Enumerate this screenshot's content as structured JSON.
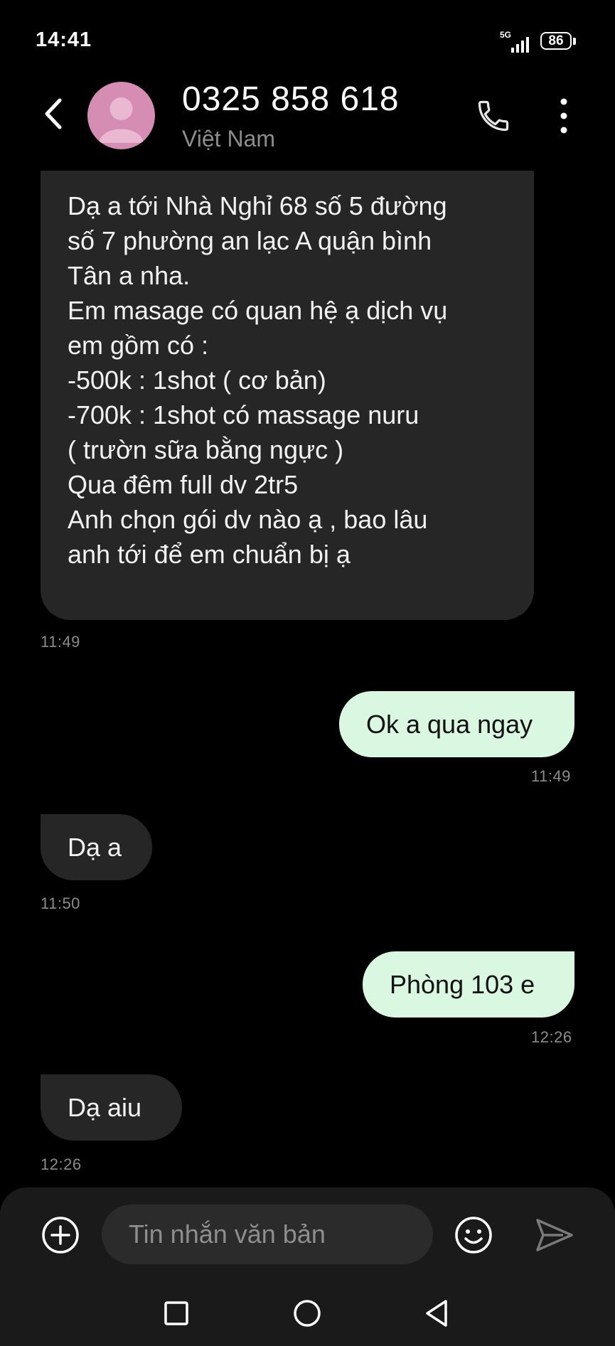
{
  "status_bar": {
    "time": "14:41",
    "network": "5G",
    "battery": "86"
  },
  "header": {
    "contact_name": "0325 858 618",
    "contact_subtitle": "Việt Nam",
    "icons": [
      "back-arrow-icon",
      "avatar-person-icon",
      "phone-icon",
      "more-vert-icon"
    ]
  },
  "messages": [
    {
      "direction": "incoming",
      "text": "Dạ a tới Nhà Nghỉ 68 số 5 đường\nsố 7 phường an lạc A quận bình\nTân a nha.\nEm masage có quan hệ ạ dịch vụ\nem gồm có :\n-500k : 1shot ( cơ bản)\n-700k : 1shot có massage nuru\n( trườn sữa bằng ngực )\nQua đêm full dv 2tr5\nAnh chọn gói dv nào ạ , bao lâu\nanh tới để em chuẩn bị ạ",
      "time": "11:49"
    },
    {
      "direction": "outgoing",
      "text": "Ok a qua ngay",
      "time": "11:49"
    },
    {
      "direction": "incoming",
      "text": "Dạ a",
      "time": "11:50"
    },
    {
      "direction": "outgoing",
      "text": "Phòng 103 e",
      "time": "12:26"
    },
    {
      "direction": "incoming",
      "text": "Dạ aiu",
      "time": "12:26"
    }
  ],
  "composer": {
    "placeholder": "Tin nhắn văn bản",
    "icons": [
      "add-circle-icon",
      "emoji-icon",
      "send-icon"
    ]
  },
  "nav_bar": {
    "icons": [
      "recent-apps-icon",
      "home-icon",
      "back-triangle-icon"
    ]
  },
  "colors": {
    "background": "#000000",
    "incoming_bubble": "#262626",
    "outgoing_bubble": "#d9f7e1",
    "avatar": "#d58db4",
    "timestamp": "#8c8c8c"
  }
}
